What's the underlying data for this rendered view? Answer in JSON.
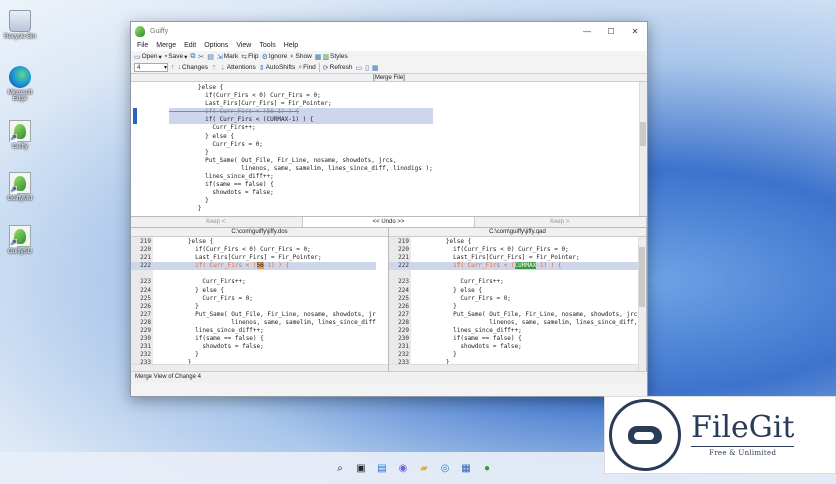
{
  "desktop": {
    "icons": [
      {
        "label": "Recycle Bin"
      },
      {
        "label": "Microsoft Edge"
      },
      {
        "label": "Guiffy"
      },
      {
        "label": "GuiffyMU"
      },
      {
        "label": "GuiffySU"
      }
    ]
  },
  "window": {
    "title": "Guiffy",
    "controls": {
      "minimize": "—",
      "maximize": "☐",
      "close": "✕"
    }
  },
  "menu": [
    "File",
    "Merge",
    "Edit",
    "Options",
    "View",
    "Tools",
    "Help"
  ],
  "toolbar": {
    "row1": {
      "open": "Open",
      "save": "Save",
      "mark": "Mark",
      "flip": "Flip",
      "ignore": "Ignore",
      "show": "Show",
      "styles": "Styles"
    },
    "row2": {
      "dropdown_value": "4",
      "changes": "Changes",
      "attentions": "Attentions",
      "autoshifts": "AutoShifts",
      "find": "Find",
      "refresh": "Refresh"
    }
  },
  "merge_pane": {
    "header": "[Merge File]",
    "lines": [
      "        }else {",
      "          if(Curr_Firs < 0) Curr_Firs = 0;",
      "          Last_Firs[Curr_Firs] = Fir_Pointer;",
      "          if( Curr_Firs < (56-1) ) {",
      "          if( Curr_Firs < (CURMAX-1) ) {",
      "            Curr_Firs++;",
      "          } else {",
      "            Curr_Firs = 0;",
      "          }",
      "          Put_Same( Out_File, Fir_Line, nosame, showdots, jrcs,",
      "                    linenos, same, samelim, lines_since_diff, linodigs );",
      "          lines_since_diff++;",
      "          if(same == false) {",
      "            showdots = false;",
      "          }",
      "        }"
    ]
  },
  "keepbar": {
    "left": "Keep <.",
    "middle": "<< Undo >>",
    "right": "Keep >."
  },
  "left_file": {
    "header": "C:\\com\\guiffy\\jiffy.dos",
    "lines": [
      {
        "n": "219",
        "t": "        }else {"
      },
      {
        "n": "220",
        "t": "          if(Curr_Firs < 0) Curr_Firs = 0;"
      },
      {
        "n": "221",
        "t": "          Last_Firs[Curr_Firs] = Fir_Pointer;"
      },
      {
        "n": "222",
        "t_pre": "          if( Curr_Firs < (",
        "t_chg": "56",
        "t_post": "-1) ) {"
      },
      {
        "n": "",
        "t": ""
      },
      {
        "n": "223",
        "t": "            Curr_Firs++;"
      },
      {
        "n": "224",
        "t": "          } else {"
      },
      {
        "n": "225",
        "t": "            Curr_Firs = 0;"
      },
      {
        "n": "226",
        "t": "          }"
      },
      {
        "n": "227",
        "t": "          Put_Same( Out_File, Fir_Line, nosame, showdots, jr"
      },
      {
        "n": "228",
        "t": "                    linenos, same, samelim, lines_since_diff"
      },
      {
        "n": "229",
        "t": "          lines_since_diff++;"
      },
      {
        "n": "230",
        "t": "          if(same == false) {"
      },
      {
        "n": "231",
        "t": "            showdots = false;"
      },
      {
        "n": "232",
        "t": "          }"
      },
      {
        "n": "233",
        "t": "        }"
      }
    ]
  },
  "right_file": {
    "header": "C:\\com\\guiffy\\jiffy.qad",
    "lines": [
      {
        "n": "219",
        "t": "        }else {"
      },
      {
        "n": "220",
        "t": "          if(Curr_Firs < 0) Curr_Firs = 0;"
      },
      {
        "n": "221",
        "t": "          Last_Firs[Curr_Firs] = Fir_Pointer;"
      },
      {
        "n": "222",
        "t_pre": "          if( Curr_Firs < (",
        "t_chg": "CURMAX",
        "t_post": "-1) ) {"
      },
      {
        "n": "",
        "t": ""
      },
      {
        "n": "223",
        "t": "            Curr_Firs++;"
      },
      {
        "n": "224",
        "t": "          } else {"
      },
      {
        "n": "225",
        "t": "            Curr_Firs = 0;"
      },
      {
        "n": "226",
        "t": "          }"
      },
      {
        "n": "227",
        "t": "          Put_Same( Out_File, Fir_Line, nosame, showdots, jrcs,"
      },
      {
        "n": "228",
        "t": "                    linenos, same, samelim, lines_since_diff,"
      },
      {
        "n": "229",
        "t": "          lines_since_diff++;"
      },
      {
        "n": "230",
        "t": "          if(same == false) {"
      },
      {
        "n": "231",
        "t": "            showdots = false;"
      },
      {
        "n": "232",
        "t": "          }"
      },
      {
        "n": "233",
        "t": "        }"
      }
    ]
  },
  "status": "Merge View of Change 4",
  "watermark": {
    "name": "FileGit",
    "tagline": "Free & Unlimited"
  },
  "colors": {
    "change_left": "#f09a45",
    "change_right": "#3c9a3c",
    "highlight": "#cdd6ea",
    "accent": "#2b62c6"
  }
}
